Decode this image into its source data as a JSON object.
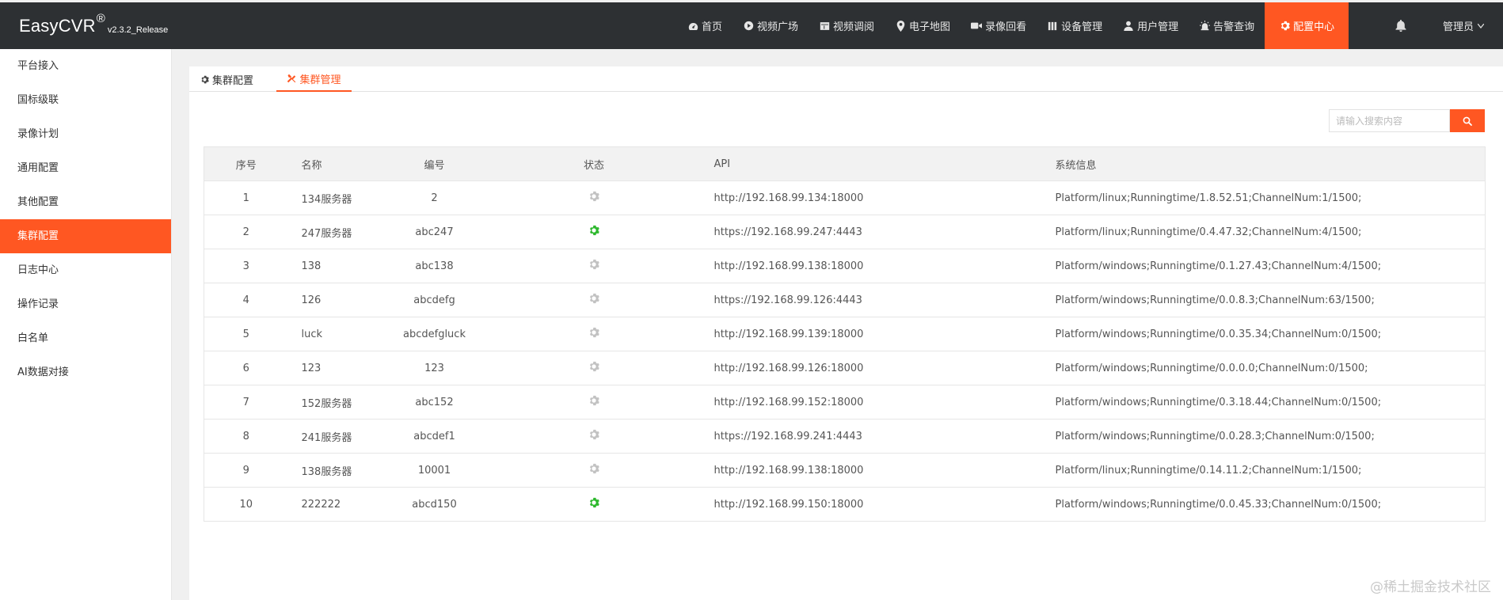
{
  "app": {
    "name": "EasyCVR",
    "reg_mark": "®",
    "version": "v2.3.2_Release"
  },
  "nav": {
    "items": [
      {
        "label": "首页",
        "icon": "dashboard-icon"
      },
      {
        "label": "视频广场",
        "icon": "play-circle-icon"
      },
      {
        "label": "视频调阅",
        "icon": "layout-icon"
      },
      {
        "label": "电子地图",
        "icon": "map-pin-icon"
      },
      {
        "label": "录像回看",
        "icon": "video-camera-icon"
      },
      {
        "label": "设备管理",
        "icon": "list-icon"
      },
      {
        "label": "用户管理",
        "icon": "user-icon"
      },
      {
        "label": "告警查询",
        "icon": "alarm-icon"
      },
      {
        "label": "配置中心",
        "icon": "gear-icon",
        "active": true
      }
    ],
    "user": "管理员"
  },
  "sidebar": {
    "items": [
      {
        "label": "平台接入"
      },
      {
        "label": "国标级联"
      },
      {
        "label": "录像计划"
      },
      {
        "label": "通用配置"
      },
      {
        "label": "其他配置"
      },
      {
        "label": "集群配置",
        "active": true
      },
      {
        "label": "日志中心"
      },
      {
        "label": "操作记录"
      },
      {
        "label": "白名单"
      },
      {
        "label": "AI数据对接"
      }
    ]
  },
  "tabs": [
    {
      "label": "集群配置",
      "icon": "gear-icon"
    },
    {
      "label": "集群管理",
      "icon": "tools-icon",
      "active": true
    }
  ],
  "search": {
    "placeholder": "请输入搜索内容",
    "value": ""
  },
  "table": {
    "headers": {
      "idx": "序号",
      "name": "名称",
      "code": "编号",
      "status": "状态",
      "api": "API",
      "sys": "系统信息"
    },
    "rows": [
      {
        "idx": "1",
        "name": "134服务器",
        "code": "2",
        "online": false,
        "api": "http://192.168.99.134:18000",
        "sys": "Platform/linux;Runningtime/1.8.52.51;ChannelNum:1/1500;"
      },
      {
        "idx": "2",
        "name": "247服务器",
        "code": "abc247",
        "online": true,
        "api": "https://192.168.99.247:4443",
        "sys": "Platform/linux;Runningtime/0.4.47.32;ChannelNum:4/1500;"
      },
      {
        "idx": "3",
        "name": "138",
        "code": "abc138",
        "online": false,
        "api": "http://192.168.99.138:18000",
        "sys": "Platform/windows;Runningtime/0.1.27.43;ChannelNum:4/1500;"
      },
      {
        "idx": "4",
        "name": "126",
        "code": "abcdefg",
        "online": false,
        "api": "https://192.168.99.126:4443",
        "sys": "Platform/windows;Runningtime/0.0.8.3;ChannelNum:63/1500;"
      },
      {
        "idx": "5",
        "name": "luck",
        "code": "abcdefgluck",
        "online": false,
        "api": "http://192.168.99.139:18000",
        "sys": "Platform/windows;Runningtime/0.0.35.34;ChannelNum:0/1500;"
      },
      {
        "idx": "6",
        "name": "123",
        "code": "123",
        "online": false,
        "api": "http://192.168.99.126:18000",
        "sys": "Platform/windows;Runningtime/0.0.0.0;ChannelNum:0/1500;"
      },
      {
        "idx": "7",
        "name": "152服务器",
        "code": "abc152",
        "online": false,
        "api": "http://192.168.99.152:18000",
        "sys": "Platform/windows;Runningtime/0.3.18.44;ChannelNum:0/1500;"
      },
      {
        "idx": "8",
        "name": "241服务器",
        "code": "abcdef1",
        "online": false,
        "api": "https://192.168.99.241:4443",
        "sys": "Platform/windows;Runningtime/0.0.28.3;ChannelNum:0/1500;"
      },
      {
        "idx": "9",
        "name": "138服务器",
        "code": "10001",
        "online": false,
        "api": "http://192.168.99.138:18000",
        "sys": "Platform/linux;Runningtime/0.14.11.2;ChannelNum:1/1500;"
      },
      {
        "idx": "10",
        "name": "222222",
        "code": "abcd150",
        "online": true,
        "api": "http://192.168.99.150:18000",
        "sys": "Platform/windows;Runningtime/0.0.45.33;ChannelNum:0/1500;"
      }
    ]
  },
  "colors": {
    "accent": "#ff5722",
    "header_bg": "#2d3033",
    "online": "#2eb82e",
    "offline": "#c2c2c2"
  },
  "watermark": "@稀土掘金技术社区"
}
